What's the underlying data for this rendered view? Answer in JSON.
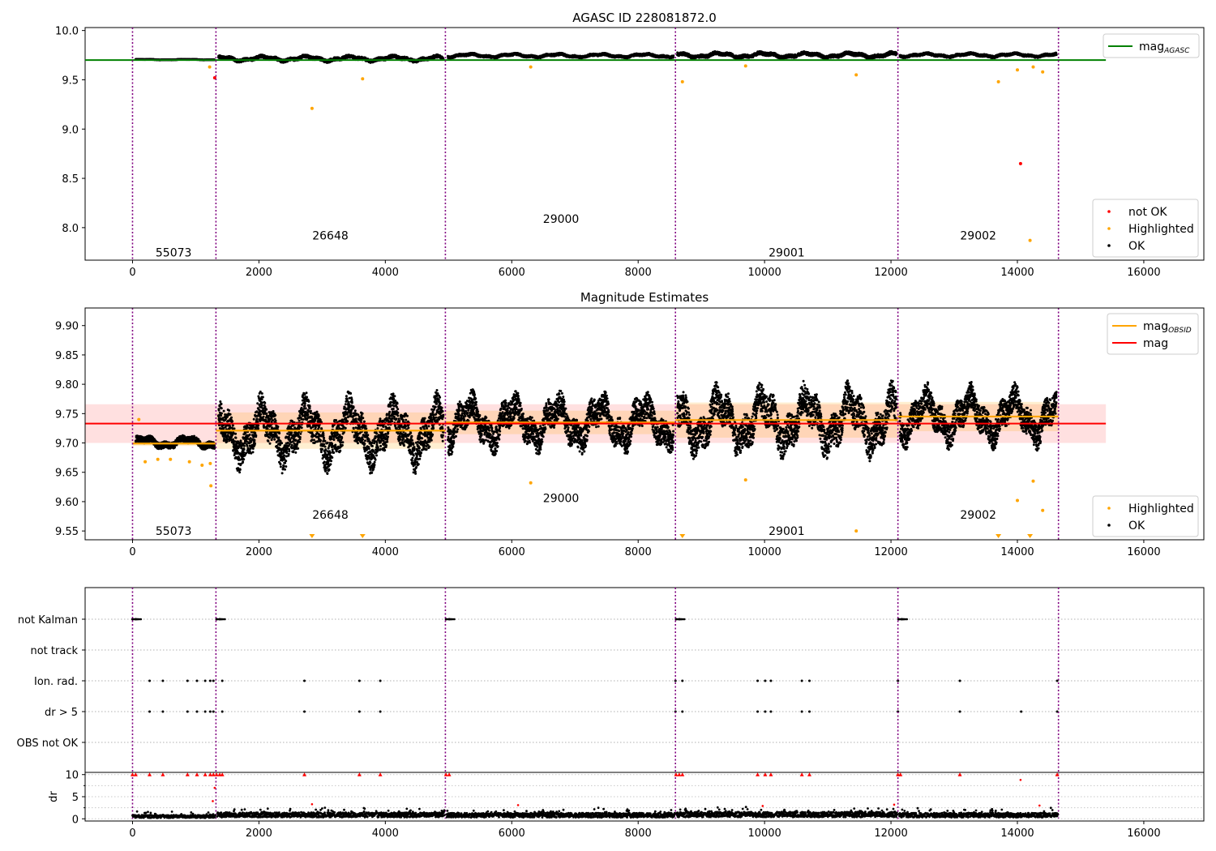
{
  "chart_data": [
    {
      "type": "scatter",
      "title": "AGASC ID 228081872.0",
      "xlim": [
        -750,
        16950
      ],
      "ylim": [
        7.67,
        10.03
      ],
      "x_ticks": [
        0,
        2000,
        4000,
        6000,
        8000,
        10000,
        12000,
        14000,
        16000
      ],
      "y_ticks": [
        8.0,
        8.5,
        9.0,
        9.5,
        10.0
      ],
      "y_tick_labels": [
        "8.0",
        "8.5",
        "9.0",
        "9.5",
        "10.0"
      ],
      "obsid_boundaries": [
        0,
        1320,
        4950,
        8590,
        12110,
        14650
      ],
      "obsid_labels": [
        {
          "text": "55073",
          "x": 650,
          "y": 7.75
        },
        {
          "text": "26648",
          "x": 3130,
          "y": 7.92
        },
        {
          "text": "29000",
          "x": 6780,
          "y": 8.09
        },
        {
          "text": "29001",
          "x": 10350,
          "y": 7.75
        },
        {
          "text": "29002",
          "x": 13380,
          "y": 7.92
        }
      ],
      "reference_line": {
        "name": "mag",
        "name_sub": "AGASC",
        "value": 9.7,
        "x_range": [
          -750,
          15400
        ],
        "color": "#008000"
      },
      "ok_bands": [
        {
          "x": [
            50,
            1300
          ],
          "center": 9.705,
          "amp": 0.005
        },
        {
          "x": [
            1360,
            4920
          ],
          "center": 9.715,
          "amp": 0.035
        },
        {
          "x": [
            4990,
            8560
          ],
          "center": 9.745,
          "amp": 0.025
        },
        {
          "x": [
            8620,
            12090
          ],
          "center": 9.75,
          "amp": 0.035
        },
        {
          "x": [
            12140,
            14620
          ],
          "center": 9.75,
          "amp": 0.025
        }
      ],
      "highlighted_points": [
        [
          1220,
          9.63
        ],
        [
          2840,
          9.21
        ],
        [
          3640,
          9.51
        ],
        [
          6300,
          9.63
        ],
        [
          8700,
          9.48
        ],
        [
          9700,
          9.64
        ],
        [
          11450,
          9.55
        ],
        [
          13700,
          9.48
        ],
        [
          14000,
          9.6
        ],
        [
          14200,
          7.87
        ],
        [
          14250,
          9.63
        ],
        [
          14400,
          9.58
        ]
      ],
      "not_ok_points": [
        [
          1300,
          9.52
        ],
        [
          14050,
          8.65
        ]
      ],
      "legend_upper": {
        "loc": "upper right",
        "entries": [
          {
            "label": "mag",
            "sub": "AGASC",
            "style": "line",
            "color": "#008000"
          }
        ]
      },
      "legend_lower": {
        "loc": "lower right",
        "entries": [
          {
            "label": "not OK",
            "style": "point",
            "color": "#ff0000"
          },
          {
            "label": "Highlighted",
            "style": "point",
            "color": "#ffa500"
          },
          {
            "label": "OK",
            "style": "point",
            "color": "#000000"
          }
        ]
      }
    },
    {
      "type": "scatter",
      "title": "Magnitude Estimates",
      "xlim": [
        -750,
        16950
      ],
      "ylim": [
        9.535,
        9.93
      ],
      "x_ticks": [
        0,
        2000,
        4000,
        6000,
        8000,
        10000,
        12000,
        14000,
        16000
      ],
      "y_ticks": [
        9.55,
        9.6,
        9.65,
        9.7,
        9.75,
        9.8,
        9.85,
        9.9
      ],
      "y_tick_labels": [
        "9.55",
        "9.60",
        "9.65",
        "9.70",
        "9.75",
        "9.80",
        "9.85",
        "9.90"
      ],
      "obsid_boundaries": [
        0,
        1320,
        4950,
        8590,
        12110,
        14650
      ],
      "obsid_labels": [
        {
          "text": "55073",
          "x": 650,
          "y": 9.55
        },
        {
          "text": "26648",
          "x": 3130,
          "y": 9.578
        },
        {
          "text": "29000",
          "x": 6780,
          "y": 9.606
        },
        {
          "text": "29001",
          "x": 10350,
          "y": 9.55
        },
        {
          "text": "29002",
          "x": 13380,
          "y": 9.578
        }
      ],
      "mag_line": {
        "name": "mag",
        "value": 9.733,
        "band": [
          9.7,
          9.766
        ],
        "x_range": [
          -750,
          15400
        ],
        "color": "#ff0000"
      },
      "mag_obsid_segments": [
        {
          "x": [
            0,
            1320
          ],
          "value": 9.699,
          "band": [
            9.695,
            9.703
          ]
        },
        {
          "x": [
            1320,
            4950
          ],
          "value": 9.721,
          "band": [
            9.69,
            9.752
          ]
        },
        {
          "x": [
            4950,
            8590
          ],
          "value": 9.735,
          "band": [
            9.715,
            9.755
          ]
        },
        {
          "x": [
            8590,
            12110
          ],
          "value": 9.739,
          "band": [
            9.709,
            9.769
          ]
        },
        {
          "x": [
            12110,
            14650
          ],
          "value": 9.745,
          "band": [
            9.72,
            9.77
          ]
        }
      ],
      "ok_bands": [
        {
          "x": [
            50,
            1300
          ],
          "center": 9.701,
          "amp": 0.012
        },
        {
          "x": [
            1360,
            4920
          ],
          "center": 9.718,
          "amp": 0.06
        },
        {
          "x": [
            4990,
            8560
          ],
          "center": 9.735,
          "amp": 0.05
        },
        {
          "x": [
            8620,
            12090
          ],
          "center": 9.738,
          "amp": 0.06
        },
        {
          "x": [
            12140,
            14620
          ],
          "center": 9.745,
          "amp": 0.05
        }
      ],
      "highlighted_points": [
        [
          100,
          9.74
        ],
        [
          200,
          9.668
        ],
        [
          400,
          9.672
        ],
        [
          600,
          9.672
        ],
        [
          900,
          9.668
        ],
        [
          1100,
          9.662
        ],
        [
          1230,
          9.665
        ],
        [
          1240,
          9.627
        ],
        [
          6300,
          9.632
        ],
        [
          9700,
          9.637
        ],
        [
          11450,
          9.55
        ],
        [
          14000,
          9.602
        ],
        [
          14250,
          9.635
        ],
        [
          14400,
          9.585
        ]
      ],
      "highlighted_below_axis": [
        2840,
        3640,
        8700,
        13700,
        14200
      ],
      "legend_upper": {
        "loc": "upper right",
        "entries": [
          {
            "label": "mag",
            "sub": "OBSID",
            "style": "line",
            "color": "#ffa500"
          },
          {
            "label": "mag",
            "style": "line",
            "color": "#ff0000"
          }
        ]
      },
      "legend_lower": {
        "loc": "lower right",
        "entries": [
          {
            "label": "Highlighted",
            "style": "point",
            "color": "#ffa500"
          },
          {
            "label": "OK",
            "style": "point",
            "color": "#000000"
          }
        ]
      }
    },
    {
      "type": "scatter",
      "title": "",
      "xlim": [
        -750,
        16950
      ],
      "x_ticks": [
        0,
        2000,
        4000,
        6000,
        8000,
        10000,
        12000,
        14000,
        16000
      ],
      "obsid_boundaries": [
        0,
        1320,
        4950,
        8590,
        12110,
        14650
      ],
      "flag_rows": [
        "not Kalman",
        "not track",
        "Ion. rad.",
        "dr > 5",
        "OBS not OK"
      ],
      "flag_points": {
        "not Kalman": [
          0,
          50,
          1330,
          1380,
          4960,
          5010,
          8600,
          8650,
          12120,
          12170
        ],
        "not track": [],
        "Ion. rad.": [
          270,
          480,
          870,
          1020,
          1150,
          1230,
          1280,
          1420,
          2720,
          3590,
          3920,
          8590,
          8700,
          9890,
          10010,
          10100,
          10590,
          10710,
          12110,
          13090,
          14630
        ],
        "dr > 5": [
          270,
          480,
          870,
          1020,
          1150,
          1230,
          1280,
          1420,
          2720,
          3590,
          3920,
          8590,
          8700,
          9890,
          10010,
          10100,
          10590,
          10710,
          12110,
          13090,
          14060,
          14630
        ],
        "OBS not OK": []
      },
      "dr_ylabel": "dr",
      "dr_ylim": [
        -0.5,
        10.5
      ],
      "dr_ticks": [
        0,
        5,
        10
      ],
      "dr_clipped_x": [
        0,
        50,
        270,
        480,
        870,
        1020,
        1150,
        1230,
        1280,
        1330,
        1380,
        1420,
        2720,
        3590,
        3920,
        4960,
        5010,
        8600,
        8650,
        8700,
        9890,
        10010,
        10100,
        10590,
        10710,
        12110,
        12150,
        13090,
        14630
      ],
      "dr_outliers": [
        [
          2840,
          3.3
        ],
        [
          6100,
          3.1
        ],
        [
          9970,
          2.9
        ],
        [
          12050,
          3.2
        ],
        [
          14050,
          8.8
        ],
        [
          14350,
          3.0
        ],
        [
          1270,
          4.0
        ],
        [
          1300,
          7.0
        ]
      ],
      "dr_base_segments": [
        [
          0,
          1310,
          0.7
        ],
        [
          1340,
          4940,
          1.2
        ],
        [
          4970,
          8580,
          1.1
        ],
        [
          8610,
          12100,
          1.3
        ],
        [
          12130,
          14640,
          1.1
        ]
      ]
    }
  ]
}
